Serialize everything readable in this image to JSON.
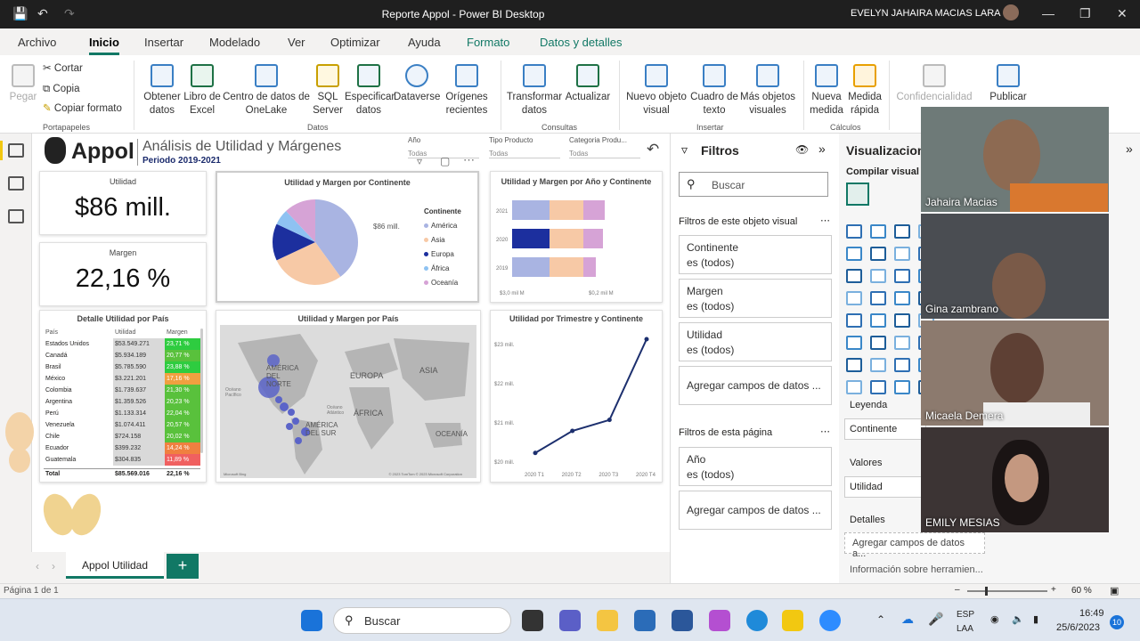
{
  "window": {
    "title": "Reporte Appol - Power BI Desktop",
    "user": "EVELYN JAHAIRA MACIAS LARA"
  },
  "tabs": [
    "Archivo",
    "Inicio",
    "Insertar",
    "Modelado",
    "Ver",
    "Optimizar",
    "Ayuda",
    "Formato",
    "Datos y detalles"
  ],
  "ribbon": {
    "pegar": "Pegar",
    "cortar": "Cortar",
    "copia": "Copia",
    "copiar_formato": "Copiar formato",
    "portapapeles": "Portapapeles",
    "obtener": "Obtener datos",
    "excel": "Libro de Excel",
    "onelake": "Centro de datos de OneLake",
    "sql": "SQL Server",
    "especificar": "Especificar datos",
    "dataverse": "Dataverse",
    "recientes": "Orígenes recientes",
    "datos": "Datos",
    "transformar": "Transformar datos",
    "actualizar": "Actualizar",
    "consultas": "Consultas",
    "nuevo_visual": "Nuevo objeto visual",
    "cuadro_texto": "Cuadro de texto",
    "mas_visuales": "Más objetos visuales",
    "insertar": "Insertar",
    "nueva_medida": "Nueva medida",
    "medida_rapida": "Medida rápida",
    "calculos": "Cálculos",
    "confidencialidad": "Confidencialidad",
    "publicar": "Publicar"
  },
  "report": {
    "brand": "Appol",
    "title": "Análisis de Utilidad y Márgenes",
    "period": "Periodo 2019-2021",
    "slicers": [
      {
        "label": "Año",
        "value": "Todas"
      },
      {
        "label": "Tipo Producto",
        "value": "Todas"
      },
      {
        "label": "Categoria Produ...",
        "value": "Todas"
      }
    ],
    "kpi_utilidad": {
      "label": "Utilidad",
      "value": "$86 mill."
    },
    "kpi_margen": {
      "label": "Margen",
      "value": "22,16 %"
    },
    "pie": {
      "title": "Utilidad y Margen por Continente",
      "legend_title": "Continente",
      "label": "$86 mill."
    },
    "bar": {
      "title": "Utilidad y Margen por Año y Continente",
      "xlabels": [
        "$3,0 mil M",
        "$0,2 mil M"
      ]
    },
    "table": {
      "title": "Detalle Utilidad por País",
      "headers": [
        "País",
        "Utilidad",
        "Margen"
      ],
      "rows": [
        [
          "Estados Unidos",
          "$53.549.271",
          "23,71 %"
        ],
        [
          "Canadá",
          "$5.934.189",
          "20,77 %"
        ],
        [
          "Brasil",
          "$5.785.590",
          "23,88 %"
        ],
        [
          "México",
          "$3.221.201",
          "17,16 %"
        ],
        [
          "Colombia",
          "$1.739.637",
          "21,30 %"
        ],
        [
          "Argentina",
          "$1.359.526",
          "20,23 %"
        ],
        [
          "Perú",
          "$1.133.314",
          "22,04 %"
        ],
        [
          "Venezuela",
          "$1.074.411",
          "20,57 %"
        ],
        [
          "Chile",
          "$724.158",
          "20,02 %"
        ],
        [
          "Ecuador",
          "$399.232",
          "14,24 %"
        ],
        [
          "Guatemala",
          "$304.835",
          "11,89 %"
        ]
      ],
      "total": [
        "Total",
        "$85.569.016",
        "22,16 %"
      ]
    },
    "map": {
      "title": "Utilidad y Margen por País",
      "labels": [
        "AMÉRICA DEL NORTE",
        "EUROPA",
        "ASIA",
        "ÁFRICA",
        "AMÉRICA DEL SUR",
        "OCEANÍA",
        "Océano Pacífico",
        "Océano Atlántico"
      ],
      "credit": "© 2023 TomTom © 2023 Microsoft Corporation",
      "bing": "Microsoft Bing"
    },
    "line": {
      "title": "Utilidad por Trimestre y Continente",
      "ylabels": [
        "$23 mill.",
        "$22 mill.",
        "$21 mill.",
        "$20 mill."
      ],
      "xlabels": [
        "2020 T1",
        "2020 T2",
        "2020 T3",
        "2020 T4"
      ]
    }
  },
  "chart_data": [
    {
      "type": "pie",
      "title": "Utilidad y Margen por Continente",
      "categories": [
        "América",
        "Asia",
        "Europa",
        "África",
        "Oceanía"
      ],
      "values": [
        40,
        28,
        14,
        6,
        12
      ],
      "colors": [
        "#a9b4e2",
        "#f7c9a6",
        "#1c2f9e",
        "#8ec2f2",
        "#d6a3d6"
      ]
    },
    {
      "type": "line",
      "title": "Utilidad por Trimestre y Continente",
      "categories": [
        "2020 T1",
        "2020 T2",
        "2020 T3",
        "2020 T4"
      ],
      "values": [
        20.2,
        20.8,
        21.1,
        23.3
      ],
      "ylim": [
        20,
        23.3
      ]
    }
  ],
  "filters": {
    "title": "Filtros",
    "search": "Buscar",
    "visual_section": "Filtros de este objeto visual",
    "items": [
      {
        "name": "Continente",
        "state": "es (todos)"
      },
      {
        "name": "Margen",
        "state": "es (todos)"
      },
      {
        "name": "Utilidad",
        "state": "es (todos)"
      }
    ],
    "add": "Agregar campos de datos ...",
    "page_section": "Filtros de esta página",
    "page_items": [
      {
        "name": "Año",
        "state": "es (todos)"
      }
    ]
  },
  "viz": {
    "title": "Visualizacion",
    "build": "Compilar visual",
    "leyenda": "Leyenda",
    "leyenda_val": "Continente",
    "valores": "Valores",
    "valores_val": "Utilidad",
    "detalles": "Detalles",
    "detalles_add": "Agregar campos de datos a...",
    "info": "Información sobre herramien..."
  },
  "participants": [
    "Jahaira Macias",
    "Gina zambrano",
    "Micaela Demera",
    "EMILY MESIAS"
  ],
  "page_tab": "Appol Utilidad",
  "status": {
    "page": "Página 1 de 1",
    "zoom": "60 %"
  },
  "taskbar": {
    "search": "Buscar",
    "lang1": "ESP",
    "lang2": "LAA",
    "time": "16:49",
    "date": "25/6/2023",
    "badge": "10"
  }
}
